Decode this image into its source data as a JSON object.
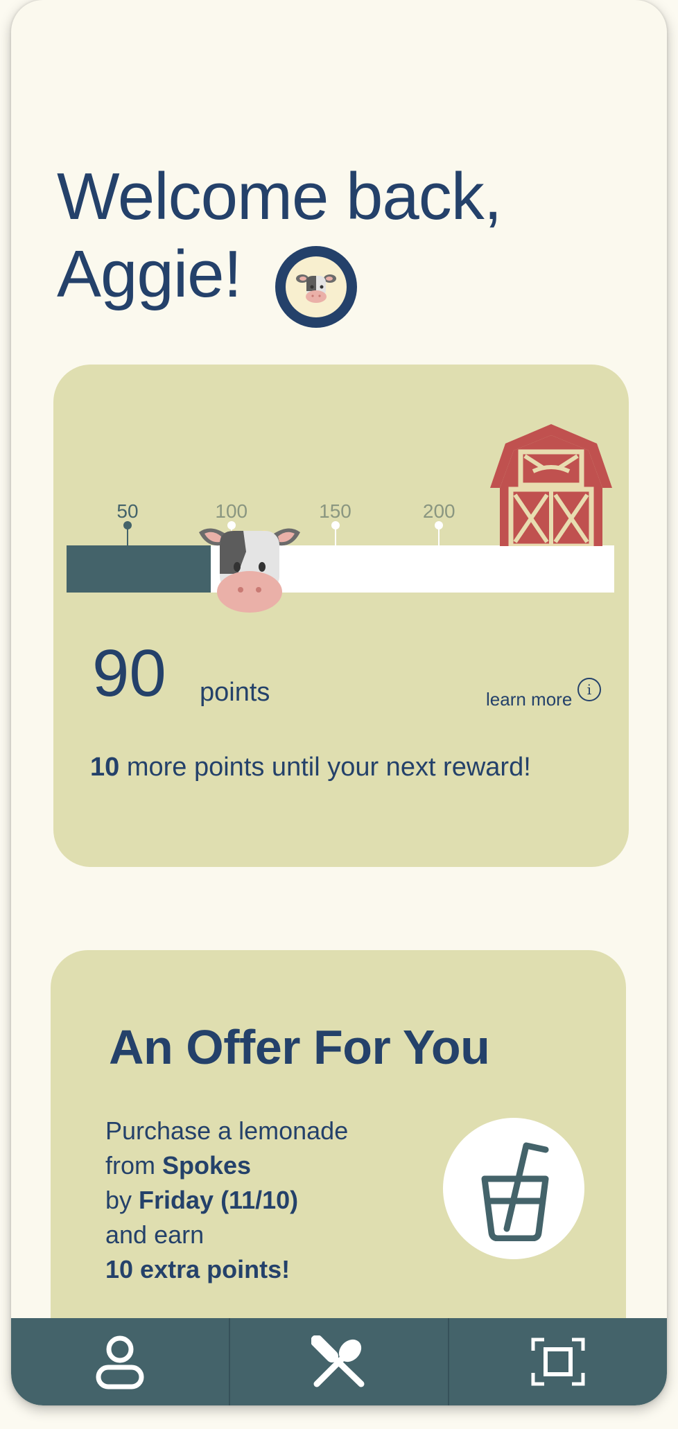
{
  "welcome": {
    "line1": "Welcome back,",
    "line2": "Aggie!",
    "avatar_icon": "cow-avatar-icon"
  },
  "points_card": {
    "ticks": [
      {
        "label": "50",
        "value": 50
      },
      {
        "label": "100",
        "value": 100
      },
      {
        "label": "150",
        "value": 150
      },
      {
        "label": "200",
        "value": 200
      }
    ],
    "progress_value": 90,
    "goal_icon": "barn-icon",
    "marker_icon": "cow-marker-icon",
    "points_value": "90",
    "points_label": "points",
    "learn_more_label": "learn more",
    "info_icon_glyph": "i",
    "next_reward_count": "10",
    "next_reward_text": " more points until your next reward!"
  },
  "offer_card": {
    "title": "An Offer For You",
    "line1": "Purchase a lemonade",
    "line2_prefix": "from ",
    "line2_bold": "Spokes",
    "line3_prefix": "by ",
    "line3_bold": "Friday (11/10)",
    "line4": "and earn",
    "line5_bold": "10 extra points!",
    "icon": "drink-cup-icon"
  },
  "nav": {
    "items": [
      {
        "name": "profile",
        "icon": "user-icon"
      },
      {
        "name": "menu",
        "icon": "fork-spoon-icon"
      },
      {
        "name": "scan",
        "icon": "scan-icon"
      }
    ]
  },
  "colors": {
    "primary": "#24416a",
    "card": "#dfdeb0",
    "progress": "#44636a",
    "background": "#fbf9ee",
    "barn": "#c0514f"
  }
}
